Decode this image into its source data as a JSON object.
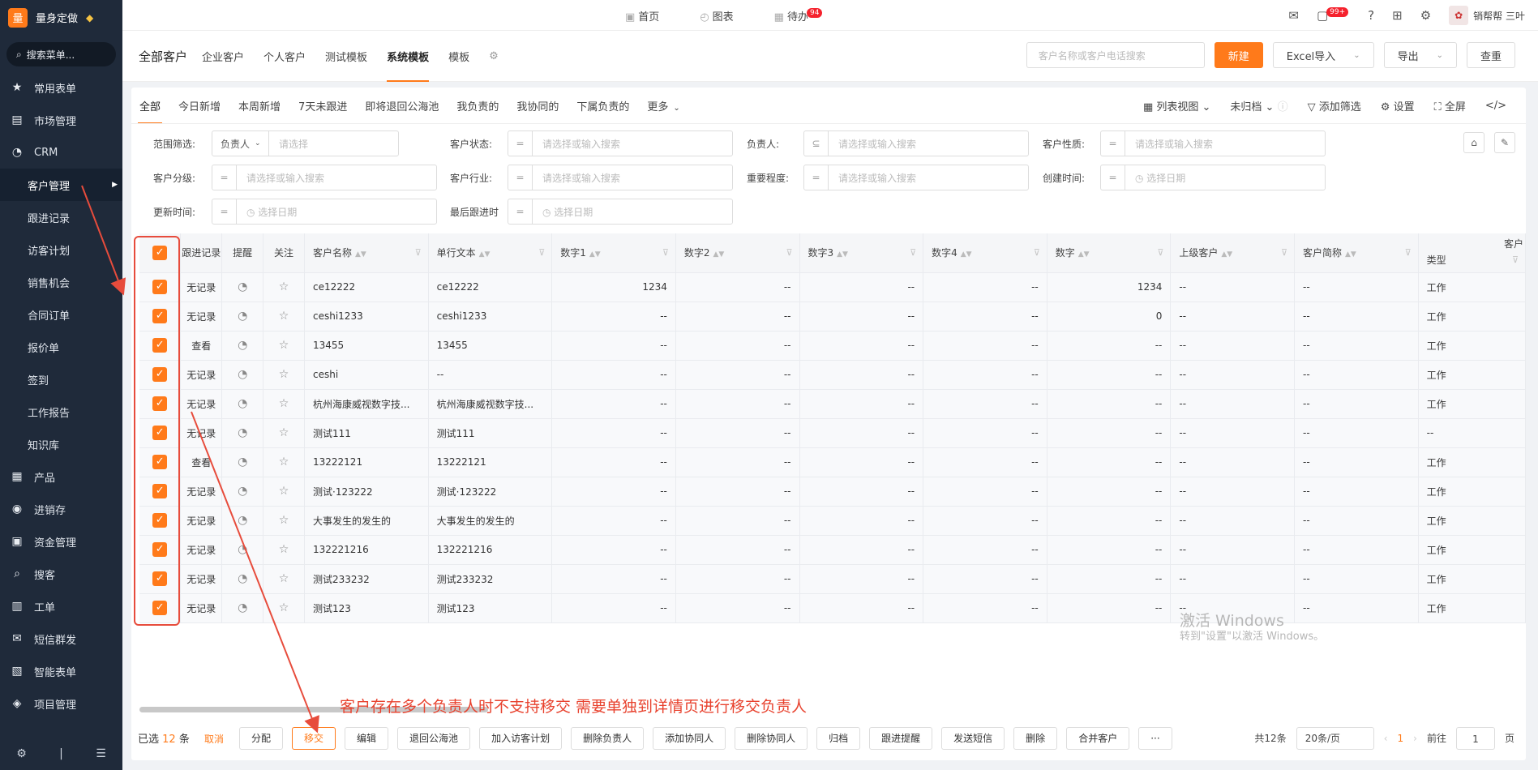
{
  "app": {
    "logo_char": "量",
    "name": "量身定做",
    "search_label": "搜索菜单..."
  },
  "sidebar": {
    "items": [
      {
        "label": "常用表单",
        "icon": "star-icon",
        "glyph": "★"
      },
      {
        "label": "市场管理",
        "icon": "clipboard-icon",
        "glyph": "▤"
      },
      {
        "label": "CRM",
        "icon": "pie-icon",
        "glyph": "◔"
      }
    ],
    "crm_sub": [
      "客户管理",
      "跟进记录",
      "访客计划",
      "销售机会",
      "合同订单",
      "报价单",
      "签到",
      "工作报告",
      "知识库"
    ],
    "items2": [
      {
        "label": "产品",
        "icon": "product-icon",
        "glyph": "▦"
      },
      {
        "label": "进销存",
        "icon": "inventory-icon",
        "glyph": "◉"
      },
      {
        "label": "资金管理",
        "icon": "finance-icon",
        "glyph": "▣"
      },
      {
        "label": "搜客",
        "icon": "search-icon",
        "glyph": "⌕"
      },
      {
        "label": "工单",
        "icon": "ticket-icon",
        "glyph": "▥"
      },
      {
        "label": "短信群发",
        "icon": "mail-icon",
        "glyph": "✉"
      },
      {
        "label": "智能表单",
        "icon": "form-icon",
        "glyph": "▧"
      },
      {
        "label": "项目管理",
        "icon": "layers-icon",
        "glyph": "◈"
      }
    ]
  },
  "topnav": {
    "home": "首页",
    "charts": "图表",
    "todo": "待办",
    "todo_badge": "94",
    "msg_badge": "99+",
    "user": "销帮帮 三叶"
  },
  "subhead": {
    "title": "全部客户",
    "tabs": [
      "企业客户",
      "个人客户",
      "测试模板",
      "系统模板",
      "模板"
    ],
    "search_placeholder": "客户名称或客户电话搜索",
    "new": "新建",
    "excel": "Excel导入",
    "export": "导出",
    "dedupe": "查重"
  },
  "viewtabs": [
    "全部",
    "今日新增",
    "本周新增",
    "7天未跟进",
    "即将退回公海池",
    "我负责的",
    "我协同的",
    "下属负责的",
    "更多"
  ],
  "viewright": {
    "list_view": "列表视图",
    "archive": "未归档",
    "add_filter": "添加筛选",
    "settings": "设置",
    "fullscreen": "全屏"
  },
  "filters": {
    "scope": "范围筛选:",
    "owner_sel": "负责人",
    "owner_ph": "请选择",
    "status": "客户状态:",
    "owner": "负责人:",
    "nature": "客户性质:",
    "level": "客户分级:",
    "industry": "客户行业:",
    "importance": "重要程度:",
    "created": "创建时间:",
    "updated": "更新时间:",
    "last_follow": "最后跟进时",
    "ph_search": "请选择或输入搜索",
    "ph_date": "选择日期"
  },
  "table": {
    "headers": [
      "跟进记录",
      "提醒",
      "关注",
      "客户名称",
      "单行文本",
      "数字1",
      "数字2",
      "数字3",
      "数字4",
      "数字",
      "上级客户",
      "客户简称",
      "类型"
    ],
    "header_extra": "客户",
    "rows": [
      [
        "无记录",
        "ce12222",
        "ce12222",
        "1234",
        "--",
        "--",
        "--",
        "1234",
        "--",
        "--",
        "工作"
      ],
      [
        "无记录",
        "ceshi1233",
        "ceshi1233",
        "--",
        "--",
        "--",
        "--",
        "0",
        "--",
        "--",
        "工作"
      ],
      [
        "查看",
        "13455",
        "13455",
        "--",
        "--",
        "--",
        "--",
        "--",
        "--",
        "--",
        "工作"
      ],
      [
        "无记录",
        "ceshi",
        "--",
        "--",
        "--",
        "--",
        "--",
        "--",
        "--",
        "--",
        "工作"
      ],
      [
        "无记录",
        "杭州海康威视数字技...",
        "杭州海康威视数字技...",
        "--",
        "--",
        "--",
        "--",
        "--",
        "--",
        "--",
        "工作"
      ],
      [
        "无记录",
        "测试111",
        "测试111",
        "--",
        "--",
        "--",
        "--",
        "--",
        "--",
        "--",
        "--"
      ],
      [
        "查看",
        "13222121",
        "13222121",
        "--",
        "--",
        "--",
        "--",
        "--",
        "--",
        "--",
        "工作"
      ],
      [
        "无记录",
        "测试·123222",
        "测试·123222",
        "--",
        "--",
        "--",
        "--",
        "--",
        "--",
        "--",
        "工作"
      ],
      [
        "无记录",
        "大事发生的发生的",
        "大事发生的发生的",
        "--",
        "--",
        "--",
        "--",
        "--",
        "--",
        "--",
        "工作"
      ],
      [
        "无记录",
        "132221216",
        "132221216",
        "--",
        "--",
        "--",
        "--",
        "--",
        "--",
        "--",
        "工作"
      ],
      [
        "无记录",
        "测试233232",
        "测试233232",
        "--",
        "--",
        "--",
        "--",
        "--",
        "--",
        "--",
        "工作"
      ],
      [
        "无记录",
        "测试123",
        "测试123",
        "--",
        "--",
        "--",
        "--",
        "--",
        "--",
        "--",
        "工作"
      ]
    ]
  },
  "annotation": "客户存在多个负责人时不支持移交 需要单独到详情页进行移交负责人",
  "footer": {
    "selected_prefix": "已选",
    "selected_count": "12",
    "selected_suffix": "条",
    "cancel": "取消",
    "buttons": [
      "分配",
      "移交",
      "编辑",
      "退回公海池",
      "加入访客计划",
      "删除负责人",
      "添加协同人",
      "删除协同人",
      "归档",
      "跟进提醒",
      "发送短信",
      "删除",
      "合并客户",
      "···"
    ],
    "total": "共12条",
    "page_size": "20条/页",
    "current_page": "1",
    "goto": "前往",
    "page_input": "1",
    "page_suffix": "页"
  },
  "watermark": {
    "line1": "激活 Windows",
    "line2": "转到\"设置\"以激活 Windows。"
  },
  "colors": {
    "accent": "#ff7a1a",
    "sidebar": "#1f2a3a",
    "annotation": "#e74c3c",
    "link": "#1a73e8"
  }
}
